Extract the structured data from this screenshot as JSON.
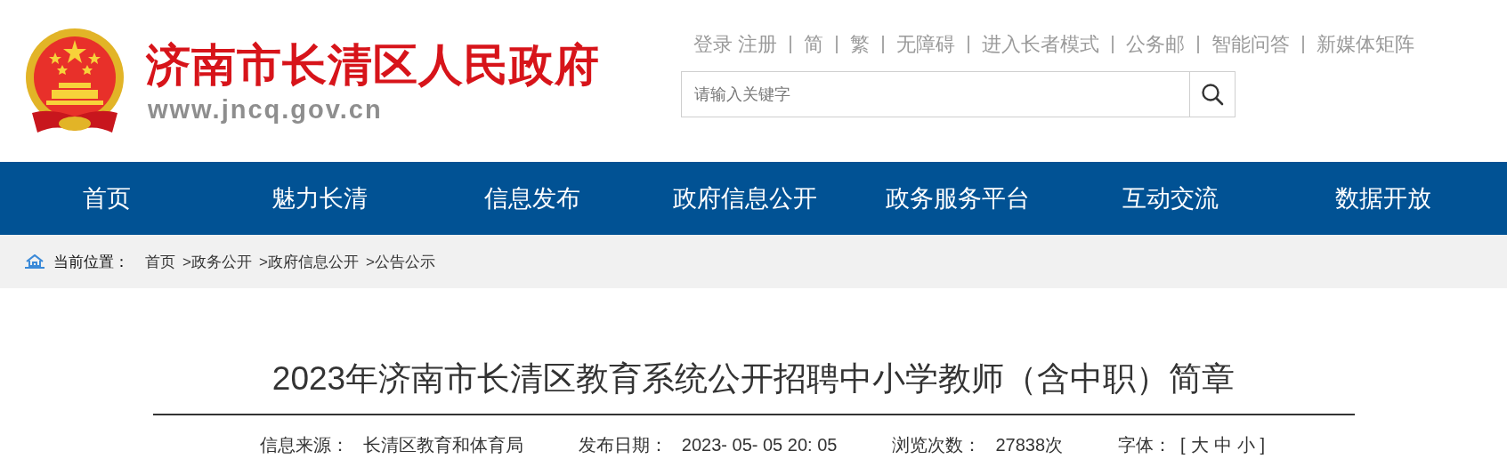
{
  "header": {
    "site_title": "济南市长清区人民政府",
    "site_url": "www.jncq.gov.cn",
    "top_links": [
      [
        "登录",
        "注册"
      ],
      [
        "简"
      ],
      [
        "繁"
      ],
      [
        "无障碍"
      ],
      [
        "进入长者模式"
      ],
      [
        "公务邮"
      ],
      [
        "智能问答"
      ],
      [
        "新媒体矩阵"
      ]
    ],
    "search": {
      "placeholder": "请输入关键字"
    }
  },
  "nav": [
    {
      "label": "首页"
    },
    {
      "label": "魅力长清"
    },
    {
      "label": "信息发布"
    },
    {
      "label": "政府信息公开"
    },
    {
      "label": "政务服务平台"
    },
    {
      "label": "互动交流"
    },
    {
      "label": "数据开放"
    }
  ],
  "breadcrumb": {
    "label": "当前位置：",
    "items": [
      "首页",
      ">政务公开",
      ">政府信息公开",
      ">公告公示"
    ]
  },
  "article": {
    "title": "2023年济南市长清区教育系统公开招聘中小学教师（含中职）简章",
    "meta": [
      {
        "label": "信息来源：",
        "value": "长清区教育和体育局"
      },
      {
        "label": "发布日期：",
        "value": "2023- 05- 05 20: 05"
      },
      {
        "label": "浏览次数：",
        "value": "27838次"
      }
    ],
    "font_size": {
      "label": "字体：",
      "open": "[",
      "options": [
        "大",
        "中",
        "小"
      ],
      "close": "]"
    }
  }
}
